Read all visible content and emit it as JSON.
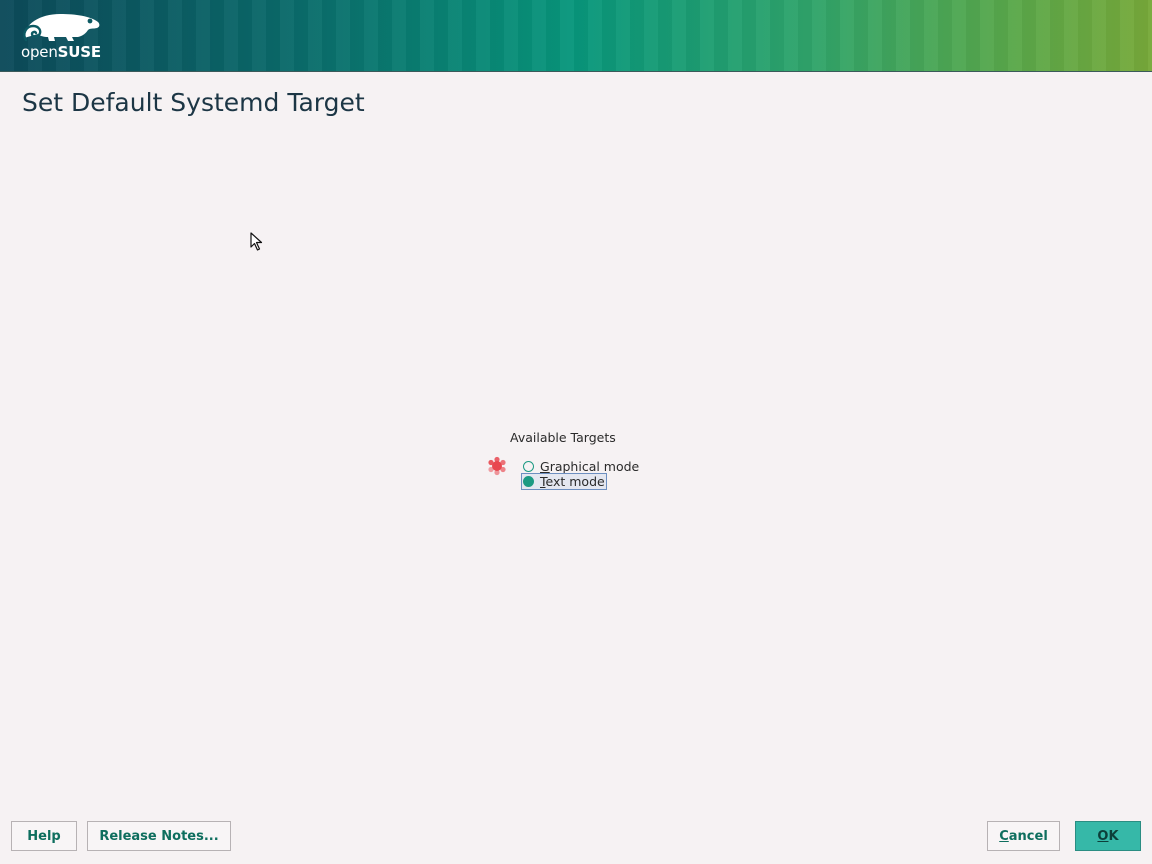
{
  "header": {
    "logo_prefix": "open",
    "logo_suffix": "SUSE",
    "logo_icon": "chameleon-icon"
  },
  "page": {
    "title": "Set Default Systemd Target"
  },
  "targets": {
    "label": "Available Targets",
    "status_icon": "busy-spinner-icon",
    "options": [
      {
        "label": "Graphical mode",
        "mnemonic": "G",
        "rest": "raphical mode",
        "selected": false
      },
      {
        "label": "Text mode",
        "mnemonic": "T",
        "rest": "ext mode",
        "selected": true
      }
    ]
  },
  "buttons": {
    "help": "Help",
    "release_notes": "Release Notes...",
    "cancel": {
      "label": "Cancel",
      "mnemonic": "C",
      "rest": "ancel"
    },
    "ok": {
      "label": "OK",
      "mnemonic": "O",
      "rest": "K"
    }
  },
  "colors": {
    "accent": "#1d9a83",
    "ok_button": "#36b8a8",
    "title_text": "#1c3645",
    "background": "#f6f2f3"
  },
  "cursor": "arrow-cursor-icon"
}
